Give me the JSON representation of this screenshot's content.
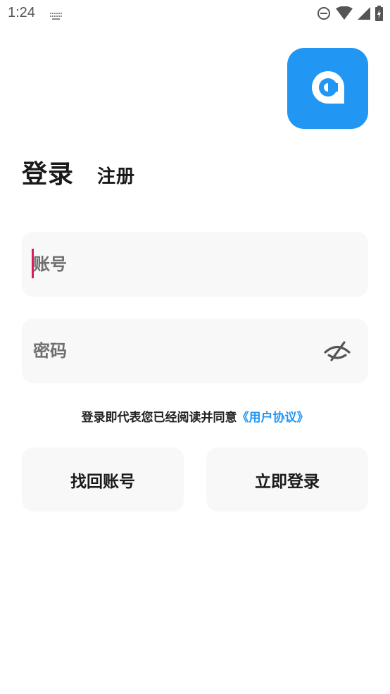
{
  "status_bar": {
    "time": "1:24",
    "icons": [
      "keyboard-icon",
      "do-not-disturb-icon",
      "wifi-icon",
      "signal-icon",
      "battery-charging-icon"
    ]
  },
  "app": {
    "logo_icon": "app-logo-icon",
    "accent_color": "#2196f3"
  },
  "tabs": {
    "login": "登录",
    "register": "注册"
  },
  "form": {
    "account_placeholder": "账号",
    "account_value": "",
    "password_placeholder": "密码",
    "password_value": "",
    "password_toggle_icon": "eye-off-icon"
  },
  "agreement": {
    "text": "登录即代表您已经阅读并同意",
    "link": "《用户协议》",
    "link_color": "#2196f3"
  },
  "buttons": {
    "recover_account": "找回账号",
    "login_now": "立即登录"
  }
}
